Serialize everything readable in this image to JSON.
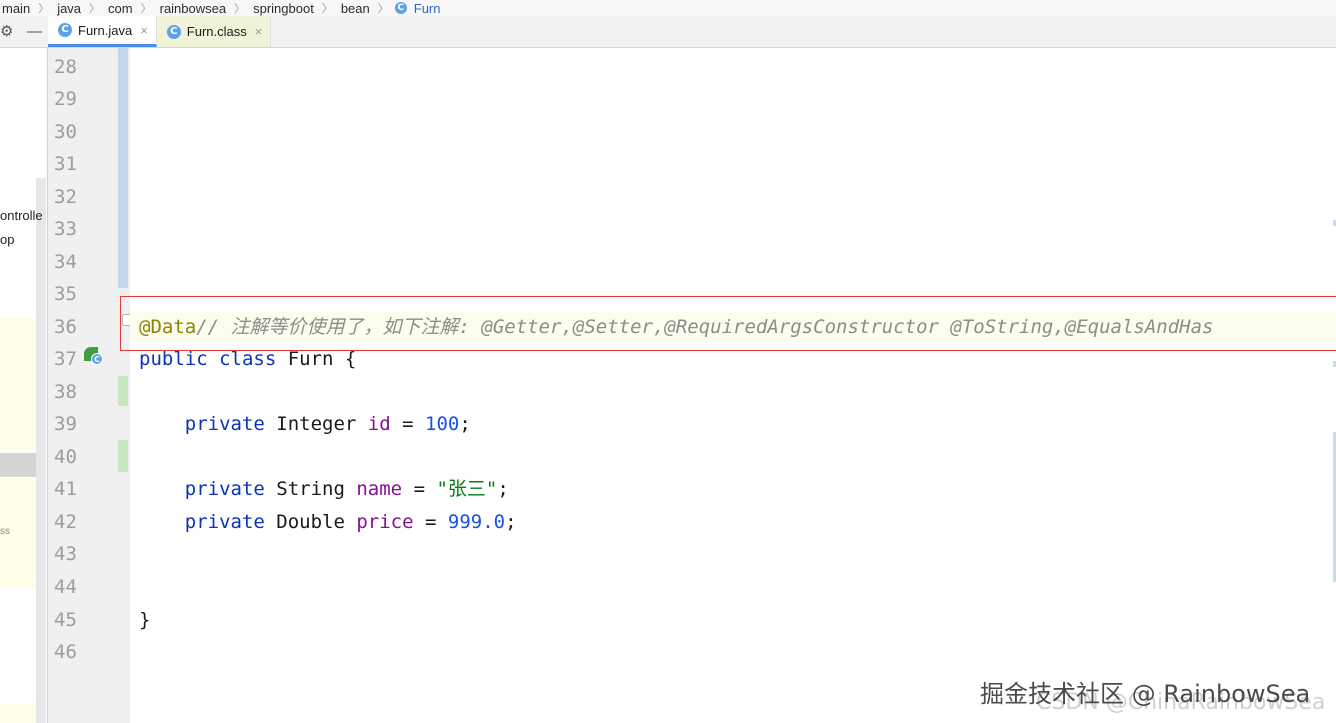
{
  "breadcrumb": [
    "main",
    "java",
    "com",
    "rainbowsea",
    "springboot",
    "bean",
    "Furn"
  ],
  "breadcrumb_last_icon": "class-c-icon",
  "tabs": [
    {
      "label": "Furn.java",
      "icon": "C",
      "active": true,
      "close": "×"
    },
    {
      "label": "Furn.class",
      "icon": "C",
      "active": false,
      "close": "×"
    }
  ],
  "toolbar": {
    "settings_icon": "⚙",
    "hide_icon": "—"
  },
  "left_panel": {
    "item1": "ontrolle",
    "item2": "op",
    "item3": "ss"
  },
  "line_numbers": [
    "28",
    "29",
    "30",
    "31",
    "32",
    "33",
    "34",
    "35",
    "36",
    "37",
    "38",
    "39",
    "40",
    "41",
    "42",
    "43",
    "44",
    "45",
    "46"
  ],
  "code": {
    "l36_annotation": "@Data",
    "l36_comment": "// 注解等价使用了，如下注解: @Getter,@Setter,@RequiredArgsConstructor @ToString,@EqualsAndHas",
    "l37_kw1": "public",
    "l37_kw2": "class",
    "l37_rest": " Furn {",
    "l39_kw": "private",
    "l39_type": " Integer ",
    "l39_field": "id",
    "l39_eq": " = ",
    "l39_num": "100",
    "l39_end": ";",
    "l41_kw": "private",
    "l41_type": " String ",
    "l41_field": "name",
    "l41_eq": " = ",
    "l41_str": "\"张三\"",
    "l41_end": ";",
    "l42_kw": "private",
    "l42_type": " Double ",
    "l42_field": "price",
    "l42_eq": " = ",
    "l42_num": "999.0",
    "l42_end": ";",
    "l45_brace": "}"
  },
  "watermark": {
    "main": "掘金技术社区 @ RainbowSea",
    "sub": "CSDN @ChinaRainbowSea"
  },
  "colors": {
    "keyword": "#0b33b8",
    "annotation": "#8e8000",
    "comment": "#8c8c8c",
    "field": "#871094",
    "number": "#1750eb",
    "string": "#067d17",
    "highlight_box": "#e03a3a"
  }
}
